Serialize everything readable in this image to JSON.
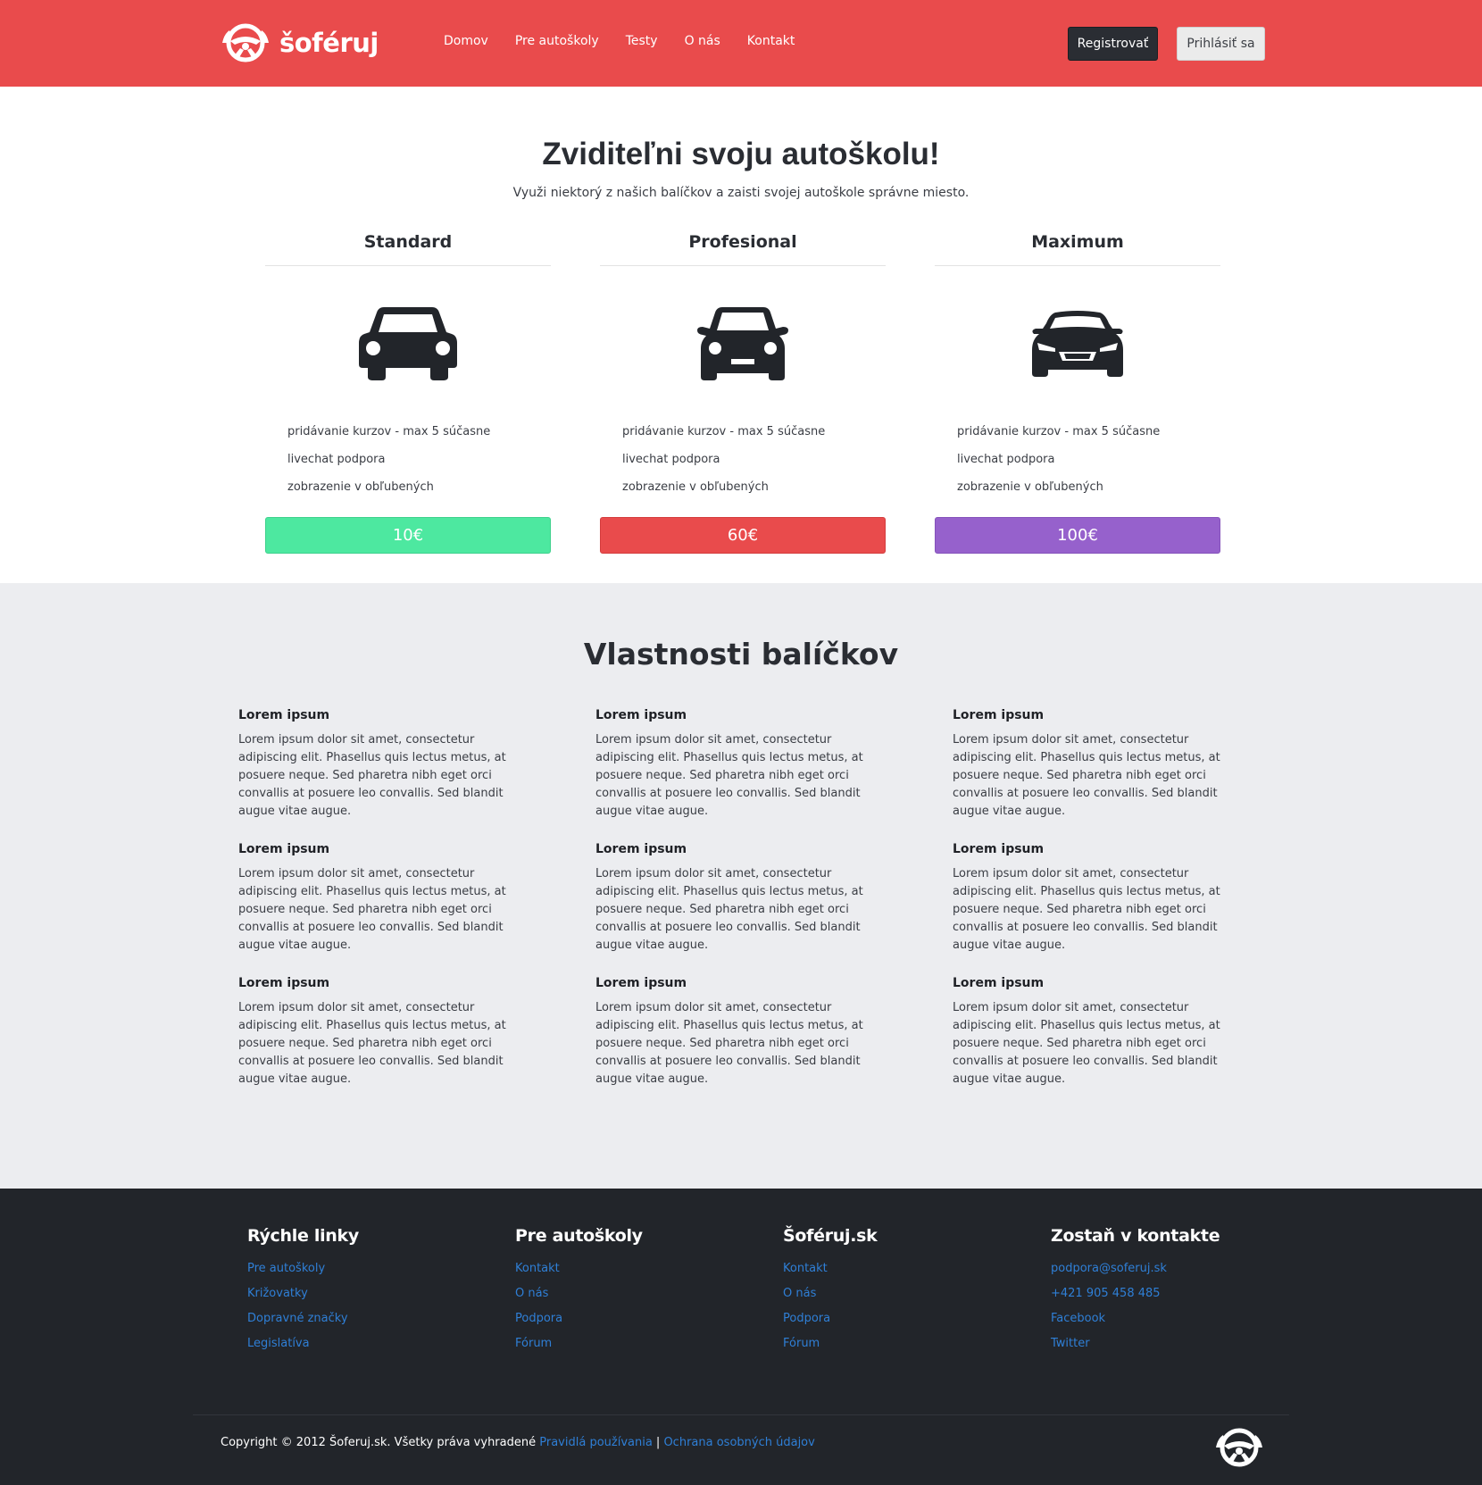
{
  "brand": {
    "name": "šoféruj",
    "accent_color": "#e94b4c",
    "logo_icon": "steering-wheel-icon"
  },
  "nav": [
    "Domov",
    "Pre autoškoly",
    "Testy",
    "O nás",
    "Kontakt"
  ],
  "header_buttons": {
    "register": "Registrovať",
    "login": "Prihlásiť sa"
  },
  "hero": {
    "title_bold": "Zviditeľni",
    "title_rest": " svoju autoškolu!",
    "subtitle": "Využi niektorý z našich balíčkov a zaisti svojej autoškole správne miesto."
  },
  "plans": [
    {
      "name": "Standard",
      "icon": "car-icon",
      "features": [
        "pridávanie kurzov - max 5 súčasne",
        "livechat podpora",
        "zobrazenie v obľubených"
      ],
      "price": "10€",
      "color": "#4de8a0"
    },
    {
      "name": "Profesional",
      "icon": "car-front-icon",
      "features": [
        "pridávanie kurzov - max 5 súčasne",
        "livechat podpora",
        "zobrazenie v obľubených"
      ],
      "price": "60€",
      "color": "#e94b4c"
    },
    {
      "name": "Maximum",
      "icon": "sports-car-icon",
      "features": [
        "pridávanie kurzov - max 5 súčasne",
        "livechat podpora",
        "zobrazenie v obľubených"
      ],
      "price": "100€",
      "color": "#9661cc"
    }
  ],
  "features_section": {
    "title": "Vlastnosti balíčkov",
    "items": [
      {
        "title": "Lorem ipsum",
        "text": "Lorem ipsum dolor sit amet, consectetur adipiscing elit. Phasellus quis lectus metus, at posuere neque. Sed pharetra nibh eget orci convallis at posuere leo convallis. Sed blandit augue vitae augue."
      },
      {
        "title": "Lorem ipsum",
        "text": "Lorem ipsum dolor sit amet, consectetur adipiscing elit. Phasellus quis lectus metus, at posuere neque. Sed pharetra nibh eget orci convallis at posuere leo convallis. Sed blandit augue vitae augue."
      },
      {
        "title": "Lorem ipsum",
        "text": "Lorem ipsum dolor sit amet, consectetur adipiscing elit. Phasellus quis lectus metus, at posuere neque. Sed pharetra nibh eget orci convallis at posuere leo convallis. Sed blandit augue vitae augue."
      },
      {
        "title": "Lorem ipsum",
        "text": "Lorem ipsum dolor sit amet, consectetur adipiscing elit. Phasellus quis lectus metus, at posuere neque. Sed pharetra nibh eget orci convallis at posuere leo convallis. Sed blandit augue vitae augue."
      },
      {
        "title": "Lorem ipsum",
        "text": "Lorem ipsum dolor sit amet, consectetur adipiscing elit. Phasellus quis lectus metus, at posuere neque. Sed pharetra nibh eget orci convallis at posuere leo convallis. Sed blandit augue vitae augue."
      },
      {
        "title": "Lorem ipsum",
        "text": "Lorem ipsum dolor sit amet, consectetur adipiscing elit. Phasellus quis lectus metus, at posuere neque. Sed pharetra nibh eget orci convallis at posuere leo convallis. Sed blandit augue vitae augue."
      },
      {
        "title": "Lorem ipsum",
        "text": "Lorem ipsum dolor sit amet, consectetur adipiscing elit. Phasellus quis lectus metus, at posuere neque. Sed pharetra nibh eget orci convallis at posuere leo convallis. Sed blandit augue vitae augue."
      },
      {
        "title": "Lorem ipsum",
        "text": "Lorem ipsum dolor sit amet, consectetur adipiscing elit. Phasellus quis lectus metus, at posuere neque. Sed pharetra nibh eget orci convallis at posuere leo convallis. Sed blandit augue vitae augue."
      },
      {
        "title": "Lorem ipsum",
        "text": "Lorem ipsum dolor sit amet, consectetur adipiscing elit. Phasellus quis lectus metus, at posuere neque. Sed pharetra nibh eget orci convallis at posuere leo convallis. Sed blandit augue vitae augue."
      }
    ]
  },
  "footer": {
    "columns": [
      {
        "title": "Rýchle linky",
        "links": [
          "Pre autoškoly",
          "Križovatky",
          "Dopravné značky",
          "Legislatíva"
        ]
      },
      {
        "title": "Pre autoškoly",
        "links": [
          "Kontakt",
          "O nás",
          "Podpora",
          "Fórum"
        ]
      },
      {
        "title": "Šoféruj.sk",
        "links": [
          "Kontakt",
          "O nás",
          "Podpora",
          "Fórum"
        ]
      },
      {
        "title": "Zostaň v kontakte",
        "links": [
          "podpora@soferuj.sk",
          "+421 905 458 485",
          "Facebook",
          "Twitter"
        ]
      }
    ],
    "copyright": "Copyright © 2012 Šoferuj.sk. Všetky práva vyhradené ",
    "terms_link": "Pravidlá používania",
    "separator": " | ",
    "privacy_link": "Ochrana osobných údajov",
    "link_color": "#2f7fd6"
  }
}
